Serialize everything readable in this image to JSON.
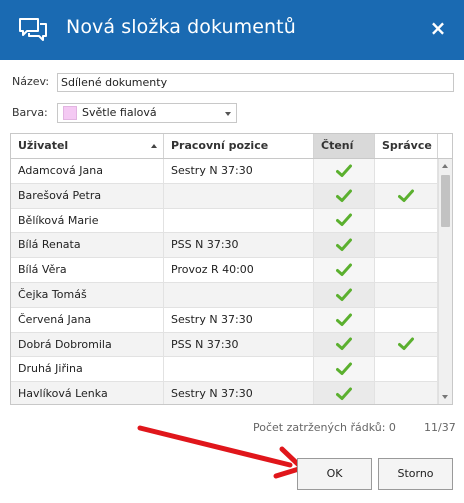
{
  "dialog": {
    "title": "Nová složka dokumentů",
    "close_label": "×"
  },
  "form": {
    "name_label": "Název:",
    "name_value": "Sdílené dokumenty",
    "color_label": "Barva:",
    "color_value": "Světle fialová",
    "color_swatch": "#f4c9f3"
  },
  "grid": {
    "columns": {
      "user": "Uživatel",
      "position": "Pracovní pozice",
      "read": "Čtení",
      "admin": "Správce"
    },
    "sorted_column": "user",
    "rows": [
      {
        "user": "Adamcová Jana",
        "position": "Sestry N 37:30",
        "read": true,
        "admin": false
      },
      {
        "user": "Barešová Petra",
        "position": "",
        "read": true,
        "admin": true
      },
      {
        "user": "Bělíková Marie",
        "position": "",
        "read": true,
        "admin": false
      },
      {
        "user": "Bílá Renata",
        "position": "PSS N 37:30",
        "read": true,
        "admin": false
      },
      {
        "user": "Bílá Věra",
        "position": "Provoz R 40:00",
        "read": true,
        "admin": false
      },
      {
        "user": "Čejka Tomáš",
        "position": "",
        "read": true,
        "admin": false
      },
      {
        "user": "Červená Jana",
        "position": "Sestry N 37:30",
        "read": true,
        "admin": false
      },
      {
        "user": "Dobrá Dobromila",
        "position": "PSS N 37:30",
        "read": true,
        "admin": true
      },
      {
        "user": "Druhá Jiřina",
        "position": "",
        "read": true,
        "admin": false
      },
      {
        "user": "Havlíková Lenka",
        "position": "Sestry N 37:30",
        "read": true,
        "admin": false
      }
    ]
  },
  "status": {
    "checked_rows": "Počet zatržených řádků: 0",
    "page_info": "11/37"
  },
  "buttons": {
    "ok": "OK",
    "cancel": "Storno"
  },
  "colors": {
    "titlebar": "#1a6ab2",
    "check": "#5bb02f",
    "annotation_arrow": "#e0161b"
  },
  "icons": {
    "title_icon": "chat-bubbles-icon",
    "check_icon": "check-icon"
  }
}
